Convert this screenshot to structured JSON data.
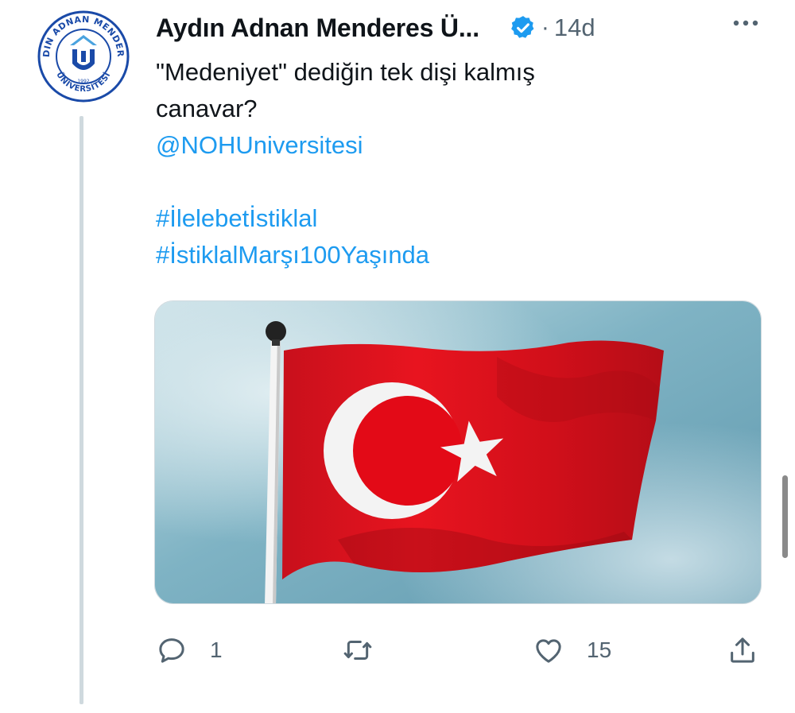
{
  "tweet": {
    "author_name": "Aydın Adnan Menderes Ü...",
    "verified": true,
    "separator": "·",
    "time_ago": "14d",
    "text_lines": [
      "\"Medeniyet\" dediğin tek dişi kalmış",
      "canavar?"
    ],
    "mention": "@NOHUniversitesi",
    "hashtags": [
      "#İlelebetİstiklal",
      "#İstiklalMarşı100Yaşında"
    ],
    "media": {
      "description_icon": "turkish-flag-image"
    }
  },
  "avatar": {
    "ring_text": "AYDIN ADNAN MENDERES",
    "bottom_text": "ÜNİVERSİTESİ",
    "year": "1992"
  },
  "actions": {
    "reply_count": "1",
    "retweet_count": "",
    "like_count": "15"
  },
  "colors": {
    "accent": "#1d9bf0",
    "secondary_text": "#536471",
    "flag_red": "#e30a17",
    "avatar_blue": "#1a4aa8"
  },
  "icons": {
    "more": "more-icon",
    "verified": "verified-badge-icon",
    "reply": "reply-icon",
    "retweet": "retweet-icon",
    "like": "like-icon",
    "share": "share-icon"
  }
}
